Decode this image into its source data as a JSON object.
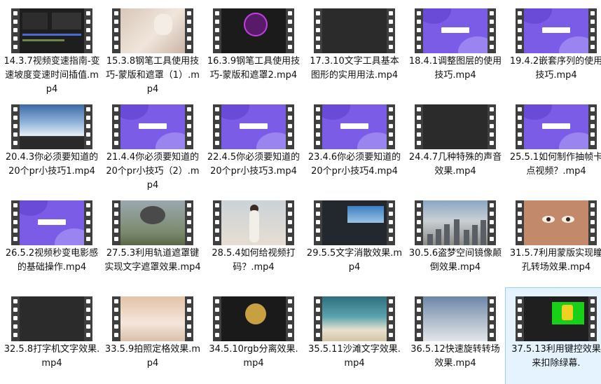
{
  "files": [
    {
      "name": "14.3.7视频变速指南-变速坡度变速时间插值.mp4",
      "thumb": "editor"
    },
    {
      "name": "15.3.8钢笔工具使用技巧-蒙版和遮罩（1）.mp4",
      "thumb": "cat"
    },
    {
      "name": "16.3.9钢笔工具使用技巧-蒙版和遮罩2.mp4",
      "thumb": "logo"
    },
    {
      "name": "17.3.10文字工具基本图形的实用用法.mp4",
      "thumb": "dark"
    },
    {
      "name": "18.4.1调整图层的使用技巧.mp4",
      "thumb": "purple"
    },
    {
      "name": "19.4.2嵌套序列的使用技巧.mp4",
      "thumb": "purple"
    },
    {
      "name": "20.4.3你必须要知道的20个pr小技巧1.mp4",
      "thumb": "cloud"
    },
    {
      "name": "21.4.4你必须要知道的20个pr小技巧（2）.mp4",
      "thumb": "purple"
    },
    {
      "name": "22.4.5你必须要知道的20个pr小技巧3.mp4",
      "thumb": "purple"
    },
    {
      "name": "23.4.6你必须要知道的20个pr小技巧4.mp4",
      "thumb": "purple"
    },
    {
      "name": "24.4.7几种特殊的声音效果.mp4",
      "thumb": "dark"
    },
    {
      "name": "25.5.1如何制作抽帧卡点视频？.mp4",
      "thumb": "purple"
    },
    {
      "name": "26.5.2视频秒变电影感的基础操作.mp4",
      "thumb": "purple"
    },
    {
      "name": "27.5.3利用轨道遮罩键实现文字遮罩效果.mp4",
      "thumb": "war"
    },
    {
      "name": "28.5.4如何给视频打码？.mp4",
      "thumb": "girl"
    },
    {
      "name": "29.5.5文字消散效果.mp4",
      "thumb": "blue"
    },
    {
      "name": "30.5.6盗梦空间镜像颠倒效果.mp4",
      "thumb": "city"
    },
    {
      "name": "31.5.7利用蒙版实现瞳孔转场效果.mp4",
      "thumb": "face"
    },
    {
      "name": "32.5.8打字机文字效果.mp4",
      "thumb": "dark"
    },
    {
      "name": "33.5.9拍照定格效果.mp4",
      "thumb": "cat2"
    },
    {
      "name": "34.5.10rgb分离效果.mp4",
      "thumb": "anim"
    },
    {
      "name": "35.5.11沙滩文字效果.mp4",
      "thumb": "beach"
    },
    {
      "name": "36.5.12快速旋转转场效果.mp4",
      "thumb": "sky"
    },
    {
      "name": "37.5.13利用键控效果来扣除绿幕.",
      "thumb": "green"
    }
  ],
  "selected_index": 23,
  "colors": {
    "selection_bg": "#e5f3ff",
    "selection_border": "#99d1ff",
    "purple": "#7b5ce6"
  }
}
